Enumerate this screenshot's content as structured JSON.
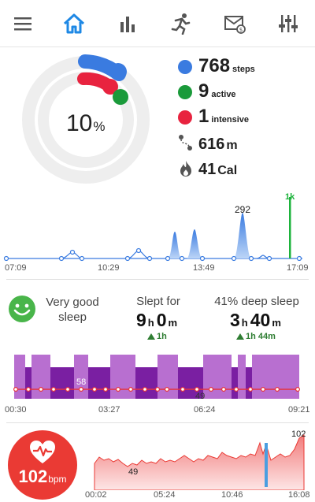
{
  "nav": {
    "icons": [
      "menu-icon",
      "home-icon",
      "bar-chart-icon",
      "running-icon",
      "mail-icon",
      "sliders-icon"
    ],
    "active": "home-icon",
    "accent": "#1e88e5"
  },
  "activity": {
    "percent": "10",
    "percent_sign": "%",
    "progress": 0.1,
    "steps": "768",
    "steps_unit": "steps",
    "active": "9",
    "active_unit": "active",
    "intensive": "1",
    "intensive_unit": "intensive",
    "distance": "616",
    "distance_unit": "m",
    "calories": "41",
    "calories_unit": "Cal",
    "colors": {
      "steps": "#3a7be0",
      "active": "#1a9a3a",
      "intensive": "#e8233f"
    }
  },
  "steps_chart": {
    "peak_label": "292",
    "goal_label": "1k",
    "x_labels": [
      "07:09",
      "10:29",
      "13:49",
      "17:09"
    ]
  },
  "sleep": {
    "quality": "Very good sleep",
    "slept_for_label": "Slept for",
    "slept_hours": "9",
    "slept_minutes": "0",
    "h_unit": "h",
    "m_unit": "m",
    "slept_delta": "1h",
    "deep_label": "41% deep sleep",
    "deep_hours": "3",
    "deep_minutes": "40",
    "deep_delta": "1h 44m",
    "hr_label_high": "58",
    "hr_label_low": "49",
    "x_labels": [
      "00:30",
      "03:27",
      "06:24",
      "09:21"
    ]
  },
  "heart": {
    "bpm": "102",
    "bpm_unit": "bpm",
    "max_label": "102",
    "min_label": "49",
    "x_labels": [
      "00:02",
      "05:24",
      "10:46",
      "16:08"
    ],
    "color": "#ea3a34"
  }
}
